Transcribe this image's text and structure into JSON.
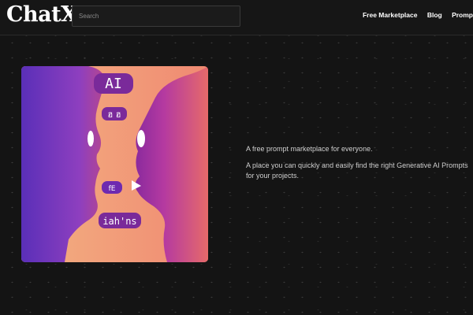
{
  "brand": {
    "logo_text": "ChatX"
  },
  "search": {
    "placeholder": "Search"
  },
  "nav": {
    "items": [
      {
        "label": "Free Marketplace"
      },
      {
        "label": "Blog"
      },
      {
        "label": "Promp"
      }
    ]
  },
  "hero": {
    "image": {
      "icon": "two-faces-illustration",
      "bubbles": [
        "AI",
        "ฮ ฮ",
        "fE",
        "iah'ns"
      ]
    },
    "tagline": "A free prompt marketplace for everyone.",
    "description": "A place you can quickly and easily find the right Generative AI Prompts for your projects."
  },
  "colors": {
    "background": "#141414",
    "accent_purple": "#6a2cc2",
    "accent_orange": "#f5a66a"
  }
}
